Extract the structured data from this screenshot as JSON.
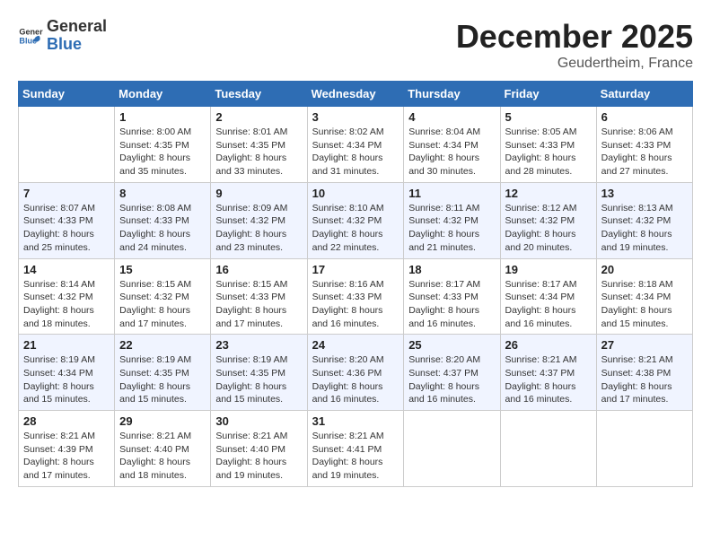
{
  "logo": {
    "general": "General",
    "blue": "Blue"
  },
  "header": {
    "month": "December 2025",
    "location": "Geudertheim, France"
  },
  "weekdays": [
    "Sunday",
    "Monday",
    "Tuesday",
    "Wednesday",
    "Thursday",
    "Friday",
    "Saturday"
  ],
  "weeks": [
    [
      {
        "day": "",
        "info": ""
      },
      {
        "day": "1",
        "info": "Sunrise: 8:00 AM\nSunset: 4:35 PM\nDaylight: 8 hours\nand 35 minutes."
      },
      {
        "day": "2",
        "info": "Sunrise: 8:01 AM\nSunset: 4:35 PM\nDaylight: 8 hours\nand 33 minutes."
      },
      {
        "day": "3",
        "info": "Sunrise: 8:02 AM\nSunset: 4:34 PM\nDaylight: 8 hours\nand 31 minutes."
      },
      {
        "day": "4",
        "info": "Sunrise: 8:04 AM\nSunset: 4:34 PM\nDaylight: 8 hours\nand 30 minutes."
      },
      {
        "day": "5",
        "info": "Sunrise: 8:05 AM\nSunset: 4:33 PM\nDaylight: 8 hours\nand 28 minutes."
      },
      {
        "day": "6",
        "info": "Sunrise: 8:06 AM\nSunset: 4:33 PM\nDaylight: 8 hours\nand 27 minutes."
      }
    ],
    [
      {
        "day": "7",
        "info": "Sunrise: 8:07 AM\nSunset: 4:33 PM\nDaylight: 8 hours\nand 25 minutes."
      },
      {
        "day": "8",
        "info": "Sunrise: 8:08 AM\nSunset: 4:33 PM\nDaylight: 8 hours\nand 24 minutes."
      },
      {
        "day": "9",
        "info": "Sunrise: 8:09 AM\nSunset: 4:32 PM\nDaylight: 8 hours\nand 23 minutes."
      },
      {
        "day": "10",
        "info": "Sunrise: 8:10 AM\nSunset: 4:32 PM\nDaylight: 8 hours\nand 22 minutes."
      },
      {
        "day": "11",
        "info": "Sunrise: 8:11 AM\nSunset: 4:32 PM\nDaylight: 8 hours\nand 21 minutes."
      },
      {
        "day": "12",
        "info": "Sunrise: 8:12 AM\nSunset: 4:32 PM\nDaylight: 8 hours\nand 20 minutes."
      },
      {
        "day": "13",
        "info": "Sunrise: 8:13 AM\nSunset: 4:32 PM\nDaylight: 8 hours\nand 19 minutes."
      }
    ],
    [
      {
        "day": "14",
        "info": "Sunrise: 8:14 AM\nSunset: 4:32 PM\nDaylight: 8 hours\nand 18 minutes."
      },
      {
        "day": "15",
        "info": "Sunrise: 8:15 AM\nSunset: 4:32 PM\nDaylight: 8 hours\nand 17 minutes."
      },
      {
        "day": "16",
        "info": "Sunrise: 8:15 AM\nSunset: 4:33 PM\nDaylight: 8 hours\nand 17 minutes."
      },
      {
        "day": "17",
        "info": "Sunrise: 8:16 AM\nSunset: 4:33 PM\nDaylight: 8 hours\nand 16 minutes."
      },
      {
        "day": "18",
        "info": "Sunrise: 8:17 AM\nSunset: 4:33 PM\nDaylight: 8 hours\nand 16 minutes."
      },
      {
        "day": "19",
        "info": "Sunrise: 8:17 AM\nSunset: 4:34 PM\nDaylight: 8 hours\nand 16 minutes."
      },
      {
        "day": "20",
        "info": "Sunrise: 8:18 AM\nSunset: 4:34 PM\nDaylight: 8 hours\nand 15 minutes."
      }
    ],
    [
      {
        "day": "21",
        "info": "Sunrise: 8:19 AM\nSunset: 4:34 PM\nDaylight: 8 hours\nand 15 minutes."
      },
      {
        "day": "22",
        "info": "Sunrise: 8:19 AM\nSunset: 4:35 PM\nDaylight: 8 hours\nand 15 minutes."
      },
      {
        "day": "23",
        "info": "Sunrise: 8:19 AM\nSunset: 4:35 PM\nDaylight: 8 hours\nand 15 minutes."
      },
      {
        "day": "24",
        "info": "Sunrise: 8:20 AM\nSunset: 4:36 PM\nDaylight: 8 hours\nand 16 minutes."
      },
      {
        "day": "25",
        "info": "Sunrise: 8:20 AM\nSunset: 4:37 PM\nDaylight: 8 hours\nand 16 minutes."
      },
      {
        "day": "26",
        "info": "Sunrise: 8:21 AM\nSunset: 4:37 PM\nDaylight: 8 hours\nand 16 minutes."
      },
      {
        "day": "27",
        "info": "Sunrise: 8:21 AM\nSunset: 4:38 PM\nDaylight: 8 hours\nand 17 minutes."
      }
    ],
    [
      {
        "day": "28",
        "info": "Sunrise: 8:21 AM\nSunset: 4:39 PM\nDaylight: 8 hours\nand 17 minutes."
      },
      {
        "day": "29",
        "info": "Sunrise: 8:21 AM\nSunset: 4:40 PM\nDaylight: 8 hours\nand 18 minutes."
      },
      {
        "day": "30",
        "info": "Sunrise: 8:21 AM\nSunset: 4:40 PM\nDaylight: 8 hours\nand 19 minutes."
      },
      {
        "day": "31",
        "info": "Sunrise: 8:21 AM\nSunset: 4:41 PM\nDaylight: 8 hours\nand 19 minutes."
      },
      {
        "day": "",
        "info": ""
      },
      {
        "day": "",
        "info": ""
      },
      {
        "day": "",
        "info": ""
      }
    ]
  ]
}
